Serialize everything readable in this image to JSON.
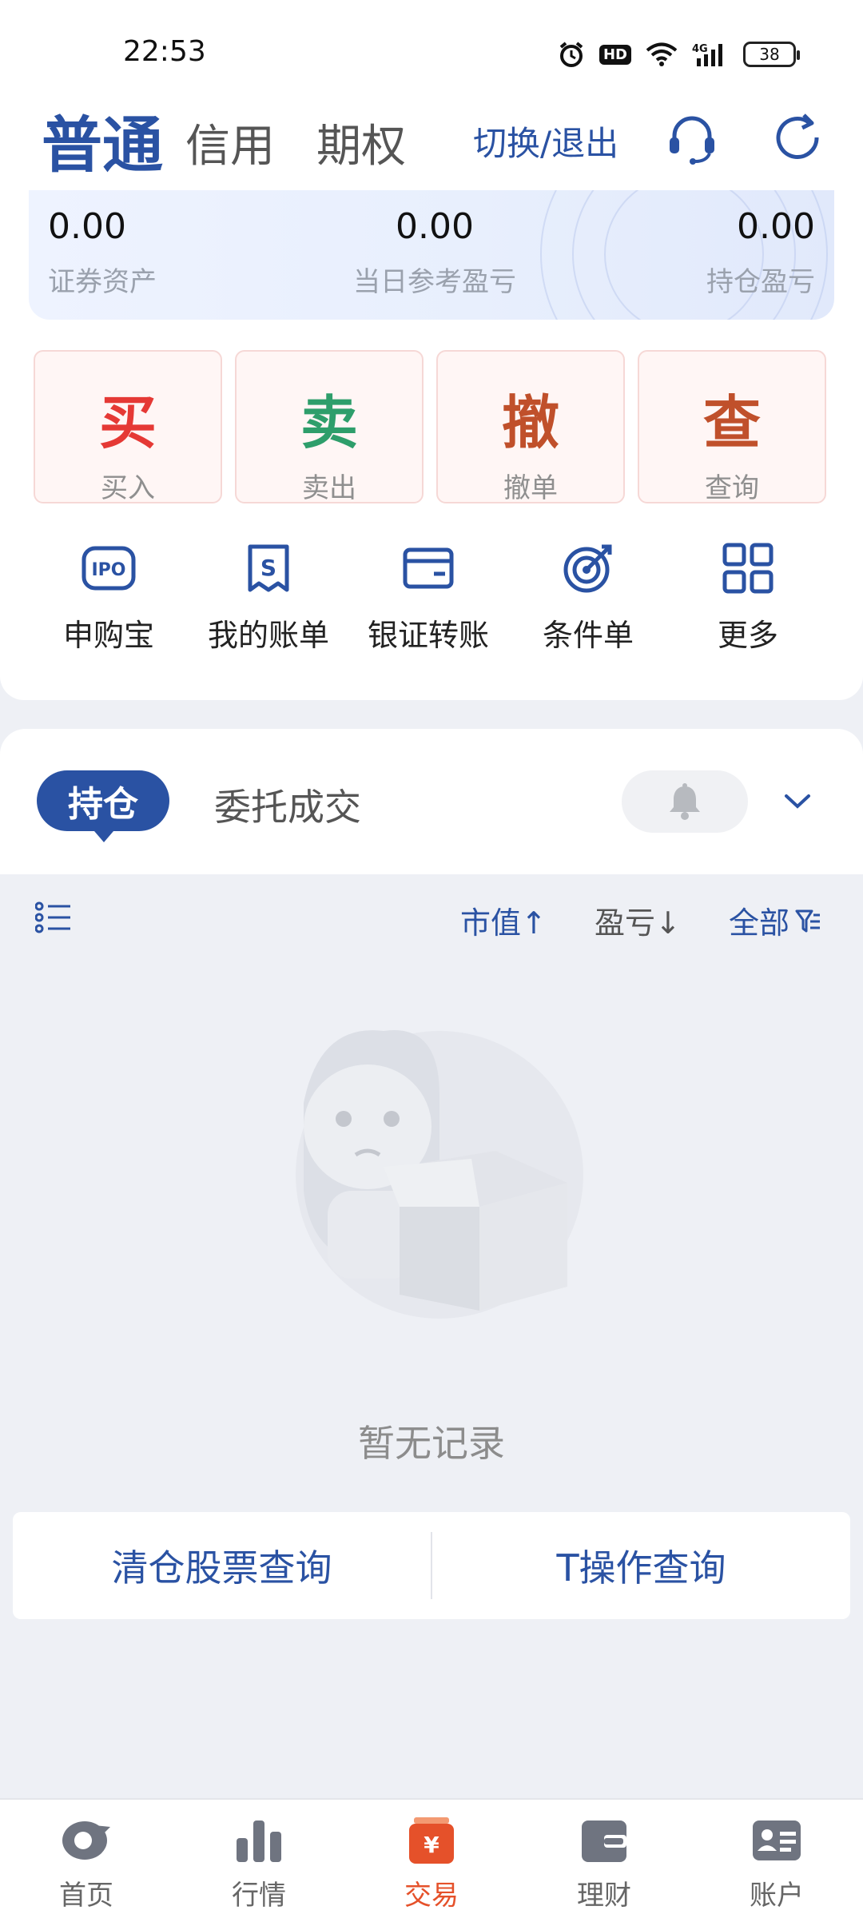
{
  "status_bar": {
    "time": "22:53",
    "hd": "HD",
    "network": "4G",
    "battery": "38"
  },
  "header": {
    "tabs": [
      "普通",
      "信用",
      "期权"
    ],
    "active_tab": "普通",
    "switch_label": "切换/退出"
  },
  "summary": {
    "securities_assets": {
      "value": "0.00",
      "label": "证券资产"
    },
    "daily_pnl": {
      "value": "0.00",
      "label": "当日参考盈亏"
    },
    "position_pnl": {
      "value": "0.00",
      "label": "持仓盈亏"
    }
  },
  "trade_buttons": [
    {
      "char": "买",
      "label": "买入",
      "color": "#e53935"
    },
    {
      "char": "卖",
      "label": "卖出",
      "color": "#2e9e6b"
    },
    {
      "char": "撤",
      "label": "撤单",
      "color": "#c0502b"
    },
    {
      "char": "查",
      "label": "查询",
      "color": "#c0502b"
    }
  ],
  "quick_links": [
    {
      "icon": "ipo-icon",
      "label": "申购宝"
    },
    {
      "icon": "bill-icon",
      "label": "我的账单"
    },
    {
      "icon": "card-icon",
      "label": "银证转账"
    },
    {
      "icon": "target-icon",
      "label": "条件单"
    },
    {
      "icon": "grid-icon",
      "label": "更多"
    }
  ],
  "holdings": {
    "tabs": [
      "持仓",
      "委托成交"
    ],
    "active_tab": "持仓",
    "sort_market_value": "市值↑",
    "sort_pnl": "盈亏↓",
    "filter_all": "全部",
    "empty_text": "暂无记录"
  },
  "query_buttons": [
    "清仓股票查询",
    "T操作查询"
  ],
  "bottom_nav": [
    {
      "icon": "home-icon",
      "label": "首页"
    },
    {
      "icon": "market-icon",
      "label": "行情"
    },
    {
      "icon": "trade-icon",
      "label": "交易",
      "active": true
    },
    {
      "icon": "wallet-icon",
      "label": "理财"
    },
    {
      "icon": "account-icon",
      "label": "账户"
    }
  ],
  "colors": {
    "primary": "#2a52a3",
    "accent": "#e5512a",
    "background": "#eef0f5"
  }
}
